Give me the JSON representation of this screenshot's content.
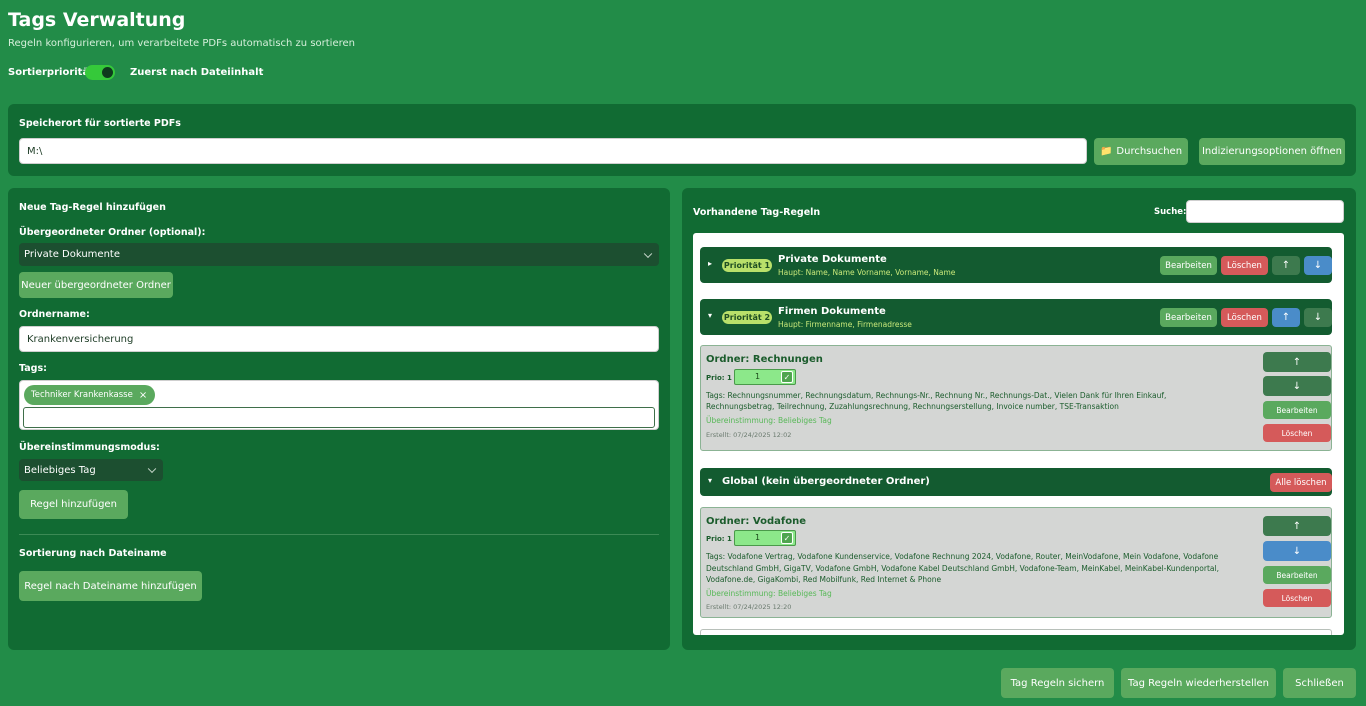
{
  "header": {
    "title": "Tags Verwaltung",
    "subtitle": "Regeln konfigurieren, um verarbeitete PDFs automatisch zu sortieren",
    "priority_label": "Sortierpriorität:",
    "priority_text": "Zuerst nach Dateiinhalt"
  },
  "storage": {
    "label": "Speicherort für sortierte PDFs",
    "path": "M:\\",
    "browse_label": "Durchsuchen",
    "indexing_label": "Indizierungsoptionen öffnen"
  },
  "new_rule": {
    "title": "Neue Tag-Regel hinzufügen",
    "parent_label": "Übergeordneter Ordner (optional):",
    "parent_value": "Private Dokumente",
    "new_parent_button": "Neuer übergeordneter Ordner",
    "folder_label": "Ordnername:",
    "folder_value": "Krankenversicherung",
    "tags_label": "Tags:",
    "tags": [
      "Techniker Krankenkasse"
    ],
    "match_label": "Übereinstimmungsmodus:",
    "match_value": "Beliebiges Tag",
    "add_rule_button": "Regel hinzufügen",
    "filename_section": "Sortierung nach Dateiname",
    "filename_button": "Regel nach Dateiname hinzufügen"
  },
  "existing": {
    "title": "Vorhandene Tag-Regeln",
    "search_label": "Suche:",
    "search_value": "",
    "groups": [
      {
        "badge": "Priorität 1",
        "name": "Private Dokumente",
        "sub": "Haupt: Name, Name Vorname, Vorname, Name",
        "edit": "Bearbeiten",
        "delete": "Löschen"
      },
      {
        "badge": "Priorität 2",
        "name": "Firmen Dokumente",
        "sub": "Haupt: Firmenname, Firmenadresse",
        "edit": "Bearbeiten",
        "delete": "Löschen"
      }
    ],
    "rules": [
      {
        "title": "Ordner: Rechnungen",
        "prio_label": "Prio: 1",
        "prio_value": "1",
        "tags_line1": "Tags: Rechnungsnummer, Rechnungsdatum, Rechnungs-Nr., Rechnung Nr., Rechnungs-Dat., Vielen Dank für Ihren Einkauf,",
        "tags_line2": "Rechnungsbetrag, Teilrechnung, Zuzahlungsrechnung, Rechnungserstellung, Invoice number, TSE-Transaktion",
        "tags_line3": "",
        "match": "Übereinstimmung: Beliebiges Tag",
        "created": "Erstellt: 07/24/2025 12:02",
        "edit": "Bearbeiten",
        "delete": "Löschen"
      },
      {
        "title": "Ordner: Vodafone",
        "prio_label": "Prio: 1",
        "prio_value": "1",
        "tags_line1": "Tags: Vodafone Vertrag, Vodafone Kundenservice, Vodafone Rechnung 2024, Vodafone, Router, MeinVodafone, Mein Vodafone, Vodafone",
        "tags_line2": "Deutschland GmbH, GigaTV, Vodafone GmbH, Vodafone Kabel Deutschland GmbH, Vodafone-Team, MeinKabel, MeinKabel-Kundenportal,",
        "tags_line3": "Vodafone.de, GigaKombi, Red Mobilfunk, Red Internet & Phone",
        "match": "Übereinstimmung: Beliebiges Tag",
        "created": "Erstellt: 07/24/2025 12:20",
        "edit": "Bearbeiten",
        "delete": "Löschen"
      }
    ],
    "global_title": "Global (kein übergeordneter Ordner)",
    "delete_all": "Alle löschen",
    "arrow_up": "↑",
    "arrow_down": "↓",
    "tri_right": "▸",
    "tri_down": "▾",
    "tag_remove": "×",
    "check_mark": "✓",
    "folder_glyph": "📁"
  },
  "footer": {
    "save": "Tag Regeln sichern",
    "restore": "Tag Regeln wiederherstellen",
    "close": "Schließen"
  },
  "colors": {
    "background": "#228c48",
    "panel": "#116b33",
    "button": "#5aa95e",
    "danger": "#d55a5a",
    "info": "#4a8cc9",
    "badge": "#b9e06a"
  }
}
